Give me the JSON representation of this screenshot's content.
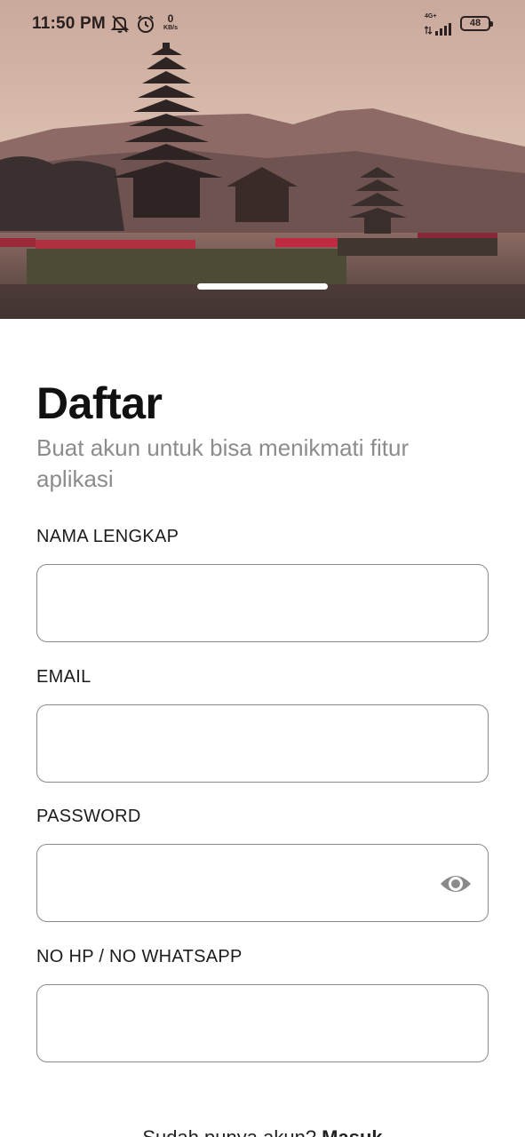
{
  "status_bar": {
    "time": "11:50 PM",
    "net_speed_value": "0",
    "net_speed_unit": "KB/s",
    "network": "4G+",
    "battery": "48",
    "icons": [
      "mute-icon",
      "alarm-icon",
      "signal-icon",
      "battery-icon"
    ]
  },
  "hero": {
    "image_semantic": "bali-temple-lake-photo"
  },
  "form": {
    "title": "Daftar",
    "subtitle": "Buat akun untuk bisa menikmati fitur aplikasi",
    "fields": [
      {
        "label": "NAMA LENGKAP",
        "value": "",
        "placeholder": ""
      },
      {
        "label": "EMAIL",
        "value": "",
        "placeholder": ""
      },
      {
        "label": "PASSWORD",
        "value": "",
        "placeholder": "",
        "icon": "eye-icon"
      },
      {
        "label": "NO HP / NO WHATSAPP",
        "value": "",
        "placeholder": ""
      }
    ]
  },
  "footer": {
    "text": "Sudah punya akun? ",
    "link": "Masuk"
  },
  "colors": {
    "title": "#111111",
    "subtitle": "#8c8c8c",
    "field_border": "#8a8a8a",
    "eye_icon": "#8a8a8a"
  }
}
